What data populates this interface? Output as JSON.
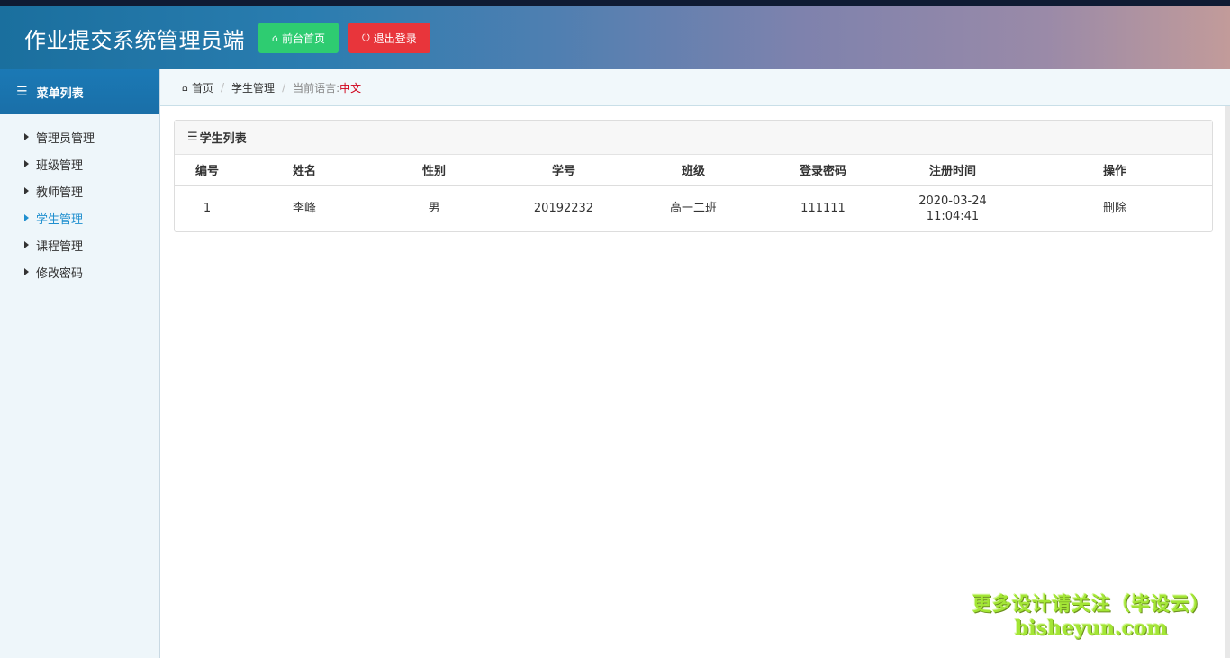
{
  "header": {
    "title": "作业提交系统管理员端",
    "home_button": "前台首页",
    "logout_button": "退出登录"
  },
  "sidebar": {
    "title": "菜单列表",
    "items": [
      {
        "label": "管理员管理"
      },
      {
        "label": "班级管理"
      },
      {
        "label": "教师管理"
      },
      {
        "label": "学生管理"
      },
      {
        "label": "课程管理"
      },
      {
        "label": "修改密码"
      }
    ],
    "active_index": 3
  },
  "breadcrumb": {
    "home": "首页",
    "current": "学生管理",
    "lang_label": "当前语言:",
    "lang_value": "中文"
  },
  "panel": {
    "title": "学生列表",
    "columns": [
      "编号",
      "姓名",
      "性别",
      "学号",
      "班级",
      "登录密码",
      "注册时间",
      "操作"
    ],
    "rows": [
      {
        "id": "1",
        "name": "李峰",
        "gender": "男",
        "student_no": "20192232",
        "class": "高一二班",
        "password": "111111",
        "reg_date": "2020-03-24",
        "reg_time": "11:04:41",
        "action": "删除"
      }
    ]
  },
  "watermark": {
    "line1": "更多设计请关注（毕设云）",
    "line2": "bisheyun.com"
  },
  "colors": {
    "accent": "#1f8fcf",
    "home_button": "#2ecc71",
    "logout_button": "#e8353b",
    "lang_value": "#d0021b"
  }
}
